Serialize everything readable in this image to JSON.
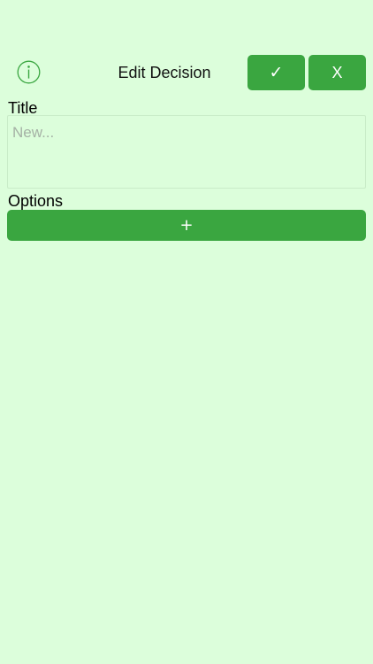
{
  "header": {
    "info_icon": "info-circle-icon",
    "title": "Edit Decision",
    "confirm_label": "✓",
    "cancel_label": "X"
  },
  "form": {
    "title_label": "Title",
    "title_placeholder": "New...",
    "title_value": "",
    "options_label": "Options",
    "add_option_label": "+"
  },
  "colors": {
    "background": "#dcfedb",
    "accent": "#3aa640",
    "button_text": "#ffffff"
  }
}
